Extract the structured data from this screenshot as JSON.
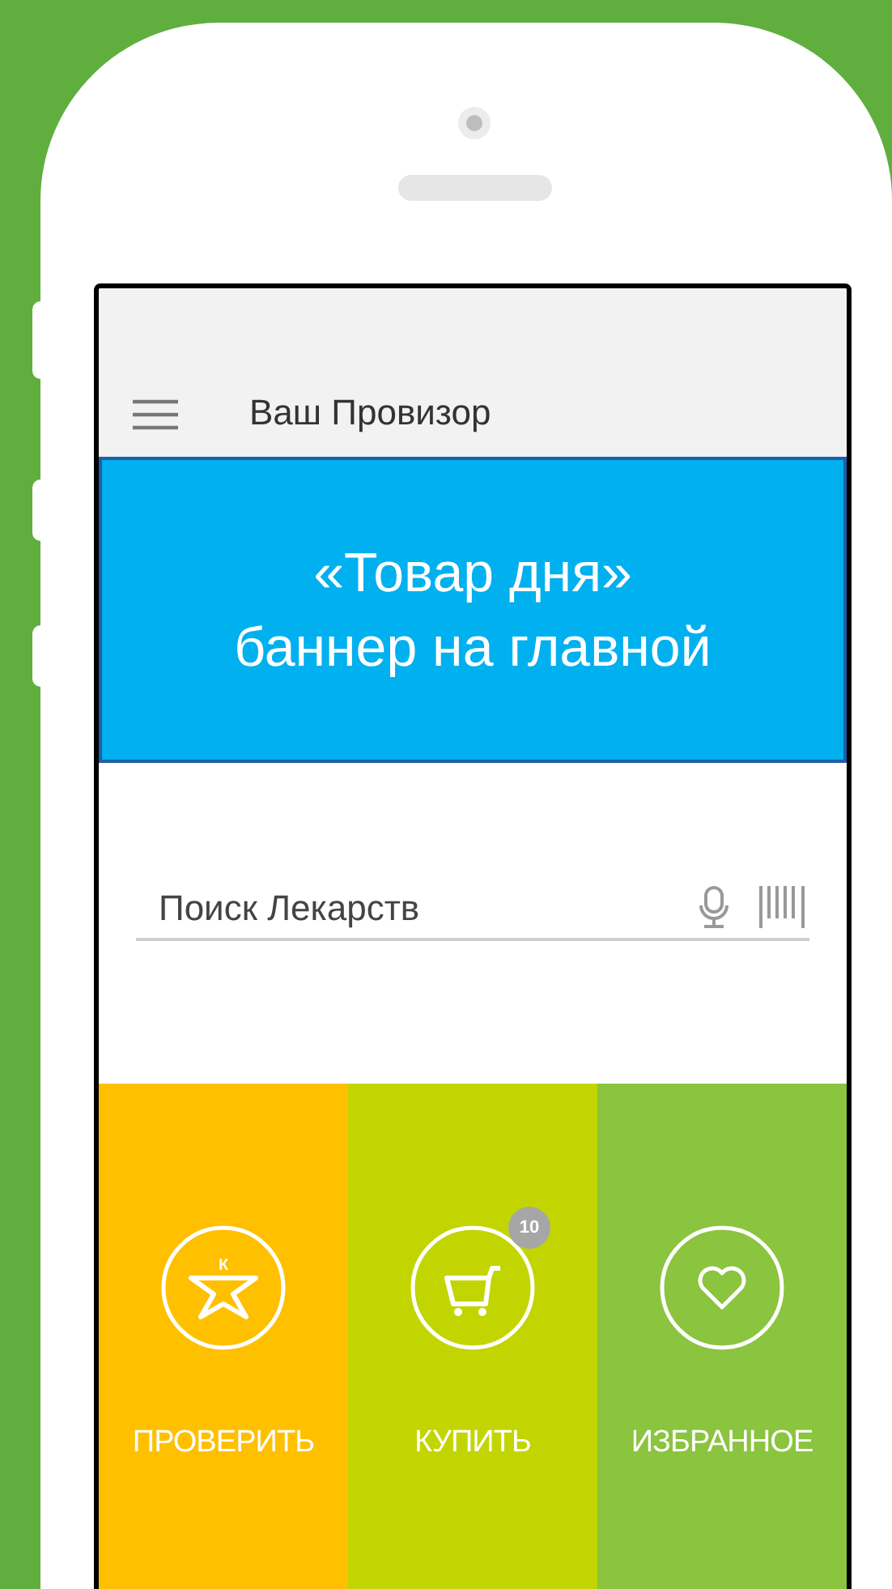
{
  "header": {
    "title": "Ваш Провизор"
  },
  "banner": {
    "lines": [
      "«Товар дня»",
      "баннер на главной"
    ]
  },
  "search": {
    "placeholder": "Поиск Лекарств"
  },
  "tiles": [
    {
      "kind": "check",
      "label": "ПРОВЕРИТЬ",
      "color": "#ffc000",
      "logo_letter": "К"
    },
    {
      "kind": "cart",
      "label": "КУПИТЬ",
      "color": "#c2d500",
      "badge": "10"
    },
    {
      "kind": "favorite",
      "label": "ИЗБРАННОЕ",
      "color": "#8bc43f"
    }
  ]
}
